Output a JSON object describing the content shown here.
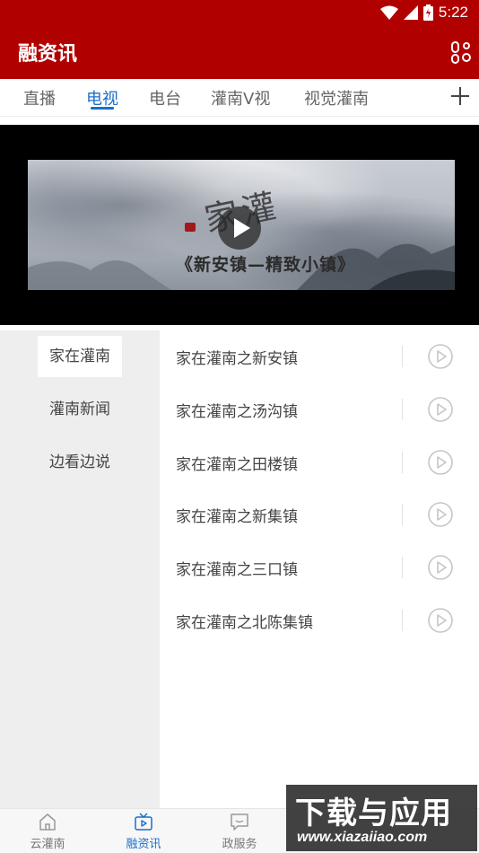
{
  "status_bar": {
    "time": "5:22",
    "icons": [
      "wifi-icon",
      "signal-icon",
      "battery-charging-icon"
    ]
  },
  "app_bar": {
    "title": "融资讯",
    "action_icon": "settings-icon"
  },
  "tabs": [
    {
      "label": "直播",
      "active": false
    },
    {
      "label": "电视",
      "active": true
    },
    {
      "label": "电台",
      "active": false
    },
    {
      "label": "灌南V视",
      "active": false
    },
    {
      "label": "视觉灌南",
      "active": false
    }
  ],
  "tabs_add_icon": "plus-icon",
  "video": {
    "calligraphy": "家灌",
    "subtitle": "《新安镇—精致小镇》",
    "play_icon": "play-icon"
  },
  "sidebar": {
    "items": [
      {
        "label": "家在灌南",
        "active": true
      },
      {
        "label": "灌南新闻",
        "active": false
      },
      {
        "label": "边看边说",
        "active": false
      }
    ]
  },
  "programs": [
    {
      "title": "家在灌南之新安镇"
    },
    {
      "title": "家在灌南之汤沟镇"
    },
    {
      "title": "家在灌南之田楼镇"
    },
    {
      "title": "家在灌南之新集镇"
    },
    {
      "title": "家在灌南之三口镇"
    },
    {
      "title": "家在灌南之北陈集镇"
    }
  ],
  "bottom_nav": [
    {
      "label": "云灌南",
      "icon": "home-icon",
      "active": false
    },
    {
      "label": "融资讯",
      "icon": "tv-icon",
      "active": true
    },
    {
      "label": "政服务",
      "icon": "chat-icon",
      "active": false
    }
  ],
  "watermark": {
    "main": "下载与应用",
    "url": "www.xiazaiiao.com"
  },
  "colors": {
    "brand_red": "#b10000",
    "accent_blue": "#1a6fc9"
  }
}
